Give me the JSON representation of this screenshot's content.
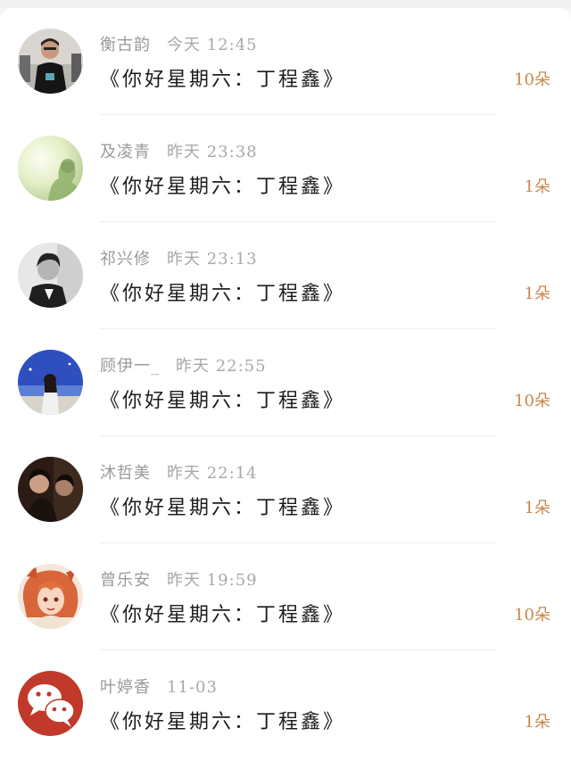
{
  "gift_list": {
    "items": [
      {
        "name": "衡古韵",
        "time": "今天 12:45",
        "title": "《你好星期六：丁程鑫》",
        "count": "10朵",
        "avatar_icon": "man-portrait-avatar"
      },
      {
        "name": "及凌青",
        "time": "昨天 23:38",
        "title": "《你好星期六：丁程鑫》",
        "count": "1朵",
        "avatar_icon": "silhouette-light-avatar"
      },
      {
        "name": "祁兴修",
        "time": "昨天 23:13",
        "title": "《你好星期六：丁程鑫》",
        "count": "1朵",
        "avatar_icon": "grayscale-portrait-avatar"
      },
      {
        "name": "顾伊一_",
        "time": "昨天 22:55",
        "title": "《你好星期六：丁程鑫》",
        "count": "10朵",
        "avatar_icon": "sea-girl-avatar"
      },
      {
        "name": "沐哲美",
        "time": "昨天 22:14",
        "title": "《你好星期六：丁程鑫》",
        "count": "1朵",
        "avatar_icon": "dark-photo-avatar"
      },
      {
        "name": "曾乐安",
        "time": "昨天 19:59",
        "title": "《你好星期六：丁程鑫》",
        "count": "10朵",
        "avatar_icon": "anime-character-avatar"
      },
      {
        "name": "叶婷香",
        "time": "11-03",
        "title": "《你好星期六：丁程鑫》",
        "count": "1朵",
        "avatar_icon": "wechat-icon"
      }
    ]
  },
  "colors": {
    "count_accent": "#c8874a",
    "wechat_red": "#c0392b",
    "name_gray": "#9a9a9a"
  }
}
